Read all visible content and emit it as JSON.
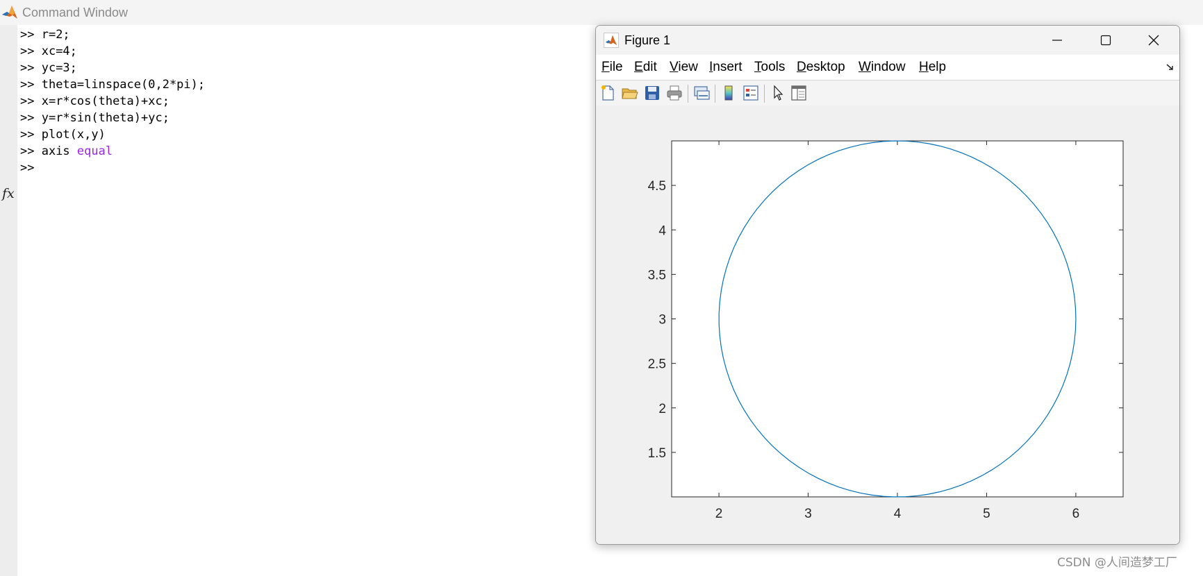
{
  "command_window": {
    "title": "Command Window",
    "lines": [
      {
        "prompt": ">> ",
        "code": "r=2;",
        "keyword": ""
      },
      {
        "prompt": ">> ",
        "code": "xc=4;",
        "keyword": ""
      },
      {
        "prompt": ">> ",
        "code": "yc=3;",
        "keyword": ""
      },
      {
        "prompt": ">> ",
        "code": "theta=linspace(0,2*pi);",
        "keyword": ""
      },
      {
        "prompt": ">> ",
        "code": "x=r*cos(theta)+xc;",
        "keyword": ""
      },
      {
        "prompt": ">> ",
        "code": "y=r*sin(theta)+yc;",
        "keyword": ""
      },
      {
        "prompt": ">> ",
        "code": "plot(x,y)",
        "keyword": ""
      },
      {
        "prompt": ">> ",
        "code": "axis ",
        "keyword": "equal"
      },
      {
        "prompt": ">> ",
        "code": "",
        "keyword": ""
      }
    ],
    "fx_icon": "fx-icon",
    "keyword_color": "#a020f0"
  },
  "figure": {
    "title": "Figure 1",
    "menu": [
      {
        "mnemonic": "F",
        "rest": "ile"
      },
      {
        "mnemonic": "E",
        "rest": "dit"
      },
      {
        "mnemonic": "V",
        "rest": "iew"
      },
      {
        "mnemonic": "I",
        "rest": "nsert"
      },
      {
        "mnemonic": "T",
        "rest": "ools"
      },
      {
        "mnemonic": "D",
        "rest": "esktop"
      },
      {
        "mnemonic": "W",
        "rest": "indow"
      },
      {
        "mnemonic": "H",
        "rest": "elp"
      }
    ],
    "toolbar_icons": [
      "new-figure-icon",
      "open-file-icon",
      "save-icon",
      "print-icon",
      "link-plot-icon",
      "colorbar-icon",
      "legend-icon",
      "edit-plot-pointer-icon",
      "property-inspector-icon"
    ],
    "window_controls": [
      "minimize-icon",
      "maximize-icon",
      "close-icon"
    ]
  },
  "chart_data": {
    "type": "line",
    "title": "",
    "xlabel": "",
    "ylabel": "",
    "xlim": [
      1.47,
      6.53
    ],
    "ylim": [
      1,
      5
    ],
    "xticks": [
      2,
      3,
      4,
      5,
      6
    ],
    "yticks": [
      1.5,
      2,
      2.5,
      3,
      3.5,
      4,
      4.5
    ],
    "xtick_labels": [
      "2",
      "3",
      "4",
      "5",
      "6"
    ],
    "ytick_labels": [
      "1.5",
      "2",
      "2.5",
      "3",
      "3.5",
      "4",
      "4.5"
    ],
    "grid": false,
    "series": [
      {
        "color": "#0072bd",
        "curve": "circle",
        "center": [
          4,
          3
        ],
        "radius": 2,
        "points": 100
      }
    ]
  },
  "watermark": "CSDN @人间造梦工厂"
}
